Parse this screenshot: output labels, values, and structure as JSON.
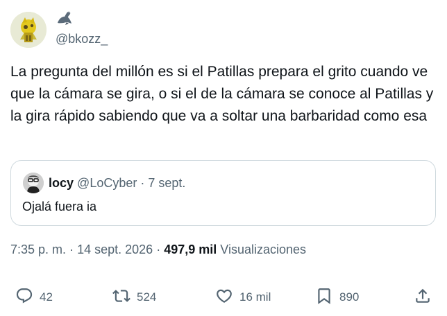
{
  "author": {
    "handle": "@bkozz_",
    "badge_icon": "seal-emoji-icon"
  },
  "tweet": {
    "text": "La pregunta del millón es si el Patillas prepara el grito cuando ve que la cámara se gira, o si el de la cámara se conoce al Patillas y la gira rápido sabiendo que va a soltar una barbaridad como esa"
  },
  "quote": {
    "name": "locy",
    "handle": "@LoCyber",
    "separator": "·",
    "date": "7 sept.",
    "text": "Ojalá fuera ia"
  },
  "meta": {
    "time": "7:35 p. m.",
    "separator": "·",
    "date": "14 sept. 2026",
    "views_count": "497,9 mil",
    "views_label": "Visualizaciones"
  },
  "actions": {
    "replies": "42",
    "retweets": "524",
    "likes": "16 mil",
    "bookmarks": "890"
  },
  "colors": {
    "text": "#0f1419",
    "secondary": "#536471",
    "border": "#cfd9de"
  }
}
